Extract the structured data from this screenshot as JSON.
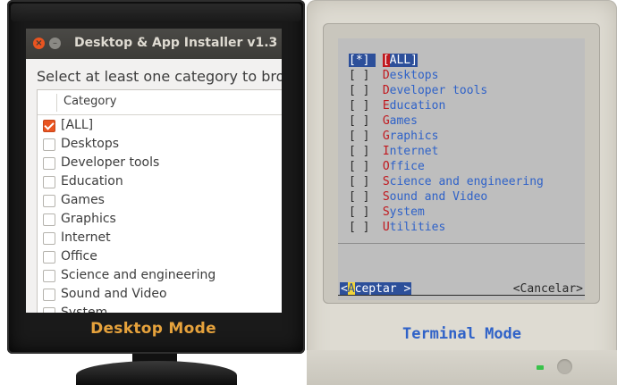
{
  "desktop": {
    "window_title": "Desktop & App Installer v1.3",
    "prompt": "Select at least one category to bro",
    "column_header": "Category",
    "items": [
      {
        "label": "[ALL]",
        "checked": true
      },
      {
        "label": "Desktops",
        "checked": false
      },
      {
        "label": "Developer tools",
        "checked": false
      },
      {
        "label": "Education",
        "checked": false
      },
      {
        "label": "Games",
        "checked": false
      },
      {
        "label": "Graphics",
        "checked": false
      },
      {
        "label": "Internet",
        "checked": false
      },
      {
        "label": "Office",
        "checked": false
      },
      {
        "label": "Science and engineering",
        "checked": false
      },
      {
        "label": "Sound and Video",
        "checked": false
      },
      {
        "label": "System",
        "checked": false
      }
    ],
    "caption": "Desktop Mode",
    "colors": {
      "accent": "#e95420",
      "caption": "#e6a23c"
    }
  },
  "terminal": {
    "items": [
      {
        "box": "[*]",
        "first": "[",
        "rest": "ALL]",
        "selected": true
      },
      {
        "box": "[ ]",
        "first": "D",
        "rest": "esktops",
        "selected": false
      },
      {
        "box": "[ ]",
        "first": "D",
        "rest": "eveloper tools",
        "selected": false
      },
      {
        "box": "[ ]",
        "first": "E",
        "rest": "ducation",
        "selected": false
      },
      {
        "box": "[ ]",
        "first": "G",
        "rest": "ames",
        "selected": false
      },
      {
        "box": "[ ]",
        "first": "G",
        "rest": "raphics",
        "selected": false
      },
      {
        "box": "[ ]",
        "first": "I",
        "rest": "nternet",
        "selected": false
      },
      {
        "box": "[ ]",
        "first": "O",
        "rest": "ffice",
        "selected": false
      },
      {
        "box": "[ ]",
        "first": "S",
        "rest": "cience and engineering",
        "selected": false
      },
      {
        "box": "[ ]",
        "first": "S",
        "rest": "ound and Video",
        "selected": false
      },
      {
        "box": "[ ]",
        "first": "S",
        "rest": "ystem",
        "selected": false
      },
      {
        "box": "[ ]",
        "first": "U",
        "rest": "tilities",
        "selected": false
      }
    ],
    "ok_button": {
      "open": "<",
      "hot": "A",
      "rest": "ceptar >"
    },
    "cancel_button": "<Cancelar>",
    "caption": "Terminal Mode",
    "colors": {
      "hotkey": "#c0181e",
      "item": "#2f62c8",
      "selection": "#2c4f9a"
    }
  }
}
